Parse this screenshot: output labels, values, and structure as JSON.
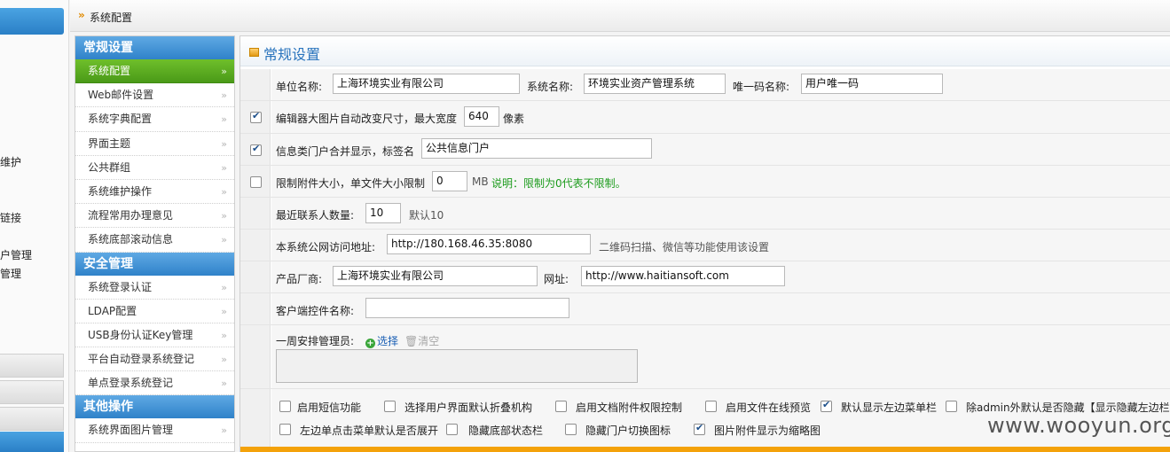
{
  "left_fragments": {
    "items": [
      "维护",
      "链接",
      "户管理",
      "管理"
    ]
  },
  "breadcrumb": {
    "arrow": "»",
    "label": "系统配置"
  },
  "menu": {
    "sections": [
      {
        "title": "常规设置",
        "items": [
          "系统配置",
          "Web邮件设置",
          "系统字典配置",
          "界面主题",
          "公共群组",
          "系统维护操作",
          "流程常用办理意见",
          "系统底部滚动信息"
        ]
      },
      {
        "title": "安全管理",
        "items": [
          "系统登录认证",
          "LDAP配置",
          "USB身份认证Key管理",
          "平台自动登录系统登记",
          "单点登录系统登记"
        ]
      },
      {
        "title": "其他操作",
        "items": [
          "系统界面图片管理"
        ]
      }
    ],
    "chevron": "»",
    "active_item": "系统配置"
  },
  "panel": {
    "title": "常规设置"
  },
  "form": {
    "row1": {
      "unit_label": "单位名称:",
      "unit_value": "上海环境实业有限公司",
      "sysname_label": "系统名称:",
      "sysname_value": "环境实业资产管理系统",
      "uid_label": "唯一码名称:",
      "uid_value": "用户唯一码"
    },
    "row2": {
      "checked": true,
      "label": "编辑器大图片自动改变尺寸，最大宽度",
      "value": "640",
      "unit": "像素"
    },
    "row3": {
      "checked": true,
      "label": "信息类门户合并显示，标签名",
      "value": "公共信息门户"
    },
    "row4": {
      "checked": false,
      "label": "限制附件大小，单文件大小限制",
      "value": "0",
      "unit": "MB",
      "note": "说明：限制为0代表不限制。"
    },
    "row5": {
      "label": "最近联系人数量:",
      "value": "10",
      "hint": "默认10"
    },
    "row6": {
      "label": "本系统公网访问地址:",
      "value": "http://180.168.46.35:8080",
      "hint": "二维码扫描、微信等功能使用该设置"
    },
    "row7": {
      "vendor_label": "产品厂商:",
      "vendor_value": "上海环境实业有限公司",
      "url_label": "网址:",
      "url_value": "http://www.haitiansoft.com"
    },
    "row8": {
      "label": "客户端控件名称:",
      "value": ""
    },
    "row9": {
      "label": "一周安排管理员:",
      "select": "选择",
      "clear": "清空",
      "textarea": ""
    },
    "options": [
      {
        "label": "启用短信功能",
        "checked": false
      },
      {
        "label": "选择用户界面默认折叠机构",
        "checked": false
      },
      {
        "label": "启用文档附件权限控制",
        "checked": false
      },
      {
        "label": "启用文件在线预览",
        "checked": false
      },
      {
        "label": "默认显示左边菜单栏",
        "checked": true
      },
      {
        "label": "除admin外默认是否隐藏【显示隐藏左边栏】",
        "checked": false
      },
      {
        "label": "左边单点击菜单默认是否展开",
        "checked": false
      },
      {
        "label": "隐藏底部状态栏",
        "checked": false
      },
      {
        "label": "隐藏门户切换图标",
        "checked": false
      },
      {
        "label": "图片附件显示为缩略图",
        "checked": true
      }
    ]
  },
  "watermark": "www.wooyun.org",
  "colors": {
    "accent_blue": "#2f82c9",
    "active_green": "#5aac20",
    "bottom_bar": "#f4a20a",
    "note_green": "#1c9b1c"
  }
}
